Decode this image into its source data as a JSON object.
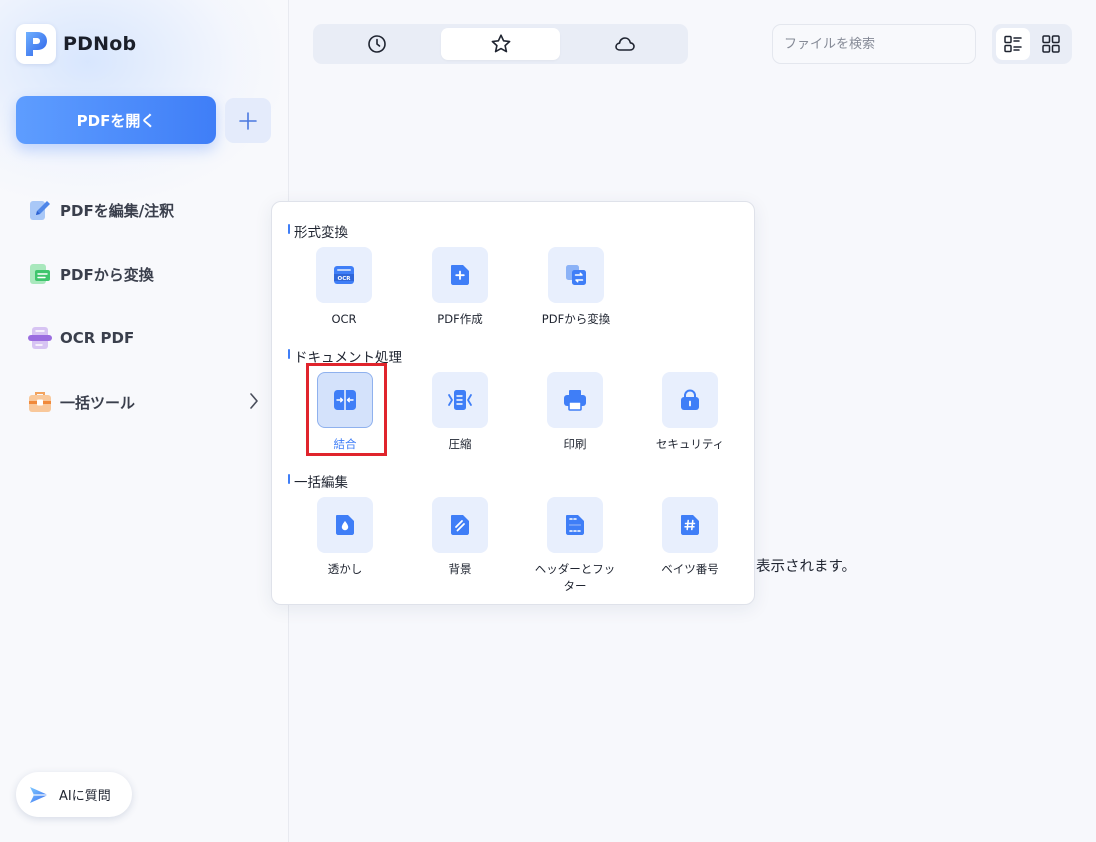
{
  "app": {
    "name": "PDNob"
  },
  "sidebar": {
    "open_pdf_label": "PDFを開く",
    "add_label": "+",
    "items": [
      {
        "label": "PDFを編集/注釈",
        "icon": "edit-pen-icon"
      },
      {
        "label": "PDFから変換",
        "icon": "convert-icon"
      },
      {
        "label": "OCR PDF",
        "icon": "ocr-icon"
      },
      {
        "label": "一括ツール",
        "icon": "toolbox-icon"
      }
    ],
    "ai_label": "AIに質問"
  },
  "topbar": {
    "tabs": [
      {
        "name": "recent",
        "icon": "clock-icon"
      },
      {
        "name": "favorites",
        "icon": "star-icon",
        "active": true
      },
      {
        "name": "cloud",
        "icon": "cloud-icon"
      }
    ],
    "search_placeholder": "ファイルを検索",
    "view": "list"
  },
  "main": {
    "empty_text": "表示されます。"
  },
  "popup": {
    "sections": [
      {
        "title": "形式変換",
        "tools": [
          {
            "label": "OCR",
            "icon": "ocr-doc-icon"
          },
          {
            "label": "PDF作成",
            "icon": "create-pdf-icon"
          },
          {
            "label": "PDFから変換",
            "icon": "convert-doc-icon"
          }
        ]
      },
      {
        "title": "ドキュメント処理",
        "tools": [
          {
            "label": "結合",
            "icon": "merge-icon",
            "selected": true
          },
          {
            "label": "圧縮",
            "icon": "compress-icon"
          },
          {
            "label": "印刷",
            "icon": "print-icon"
          },
          {
            "label": "セキュリティ",
            "icon": "lock-icon"
          }
        ]
      },
      {
        "title": "一括編集",
        "tools": [
          {
            "label": "透かし",
            "icon": "watermark-icon"
          },
          {
            "label": "背景",
            "icon": "background-icon"
          },
          {
            "label": "ヘッダーとフッター",
            "icon": "header-footer-icon"
          },
          {
            "label": "ベイツ番号",
            "icon": "bates-number-icon"
          }
        ]
      }
    ]
  },
  "colors": {
    "accent": "#3f7ef7",
    "highlight": "#e0242c",
    "tile_bg": "#e8effd"
  }
}
